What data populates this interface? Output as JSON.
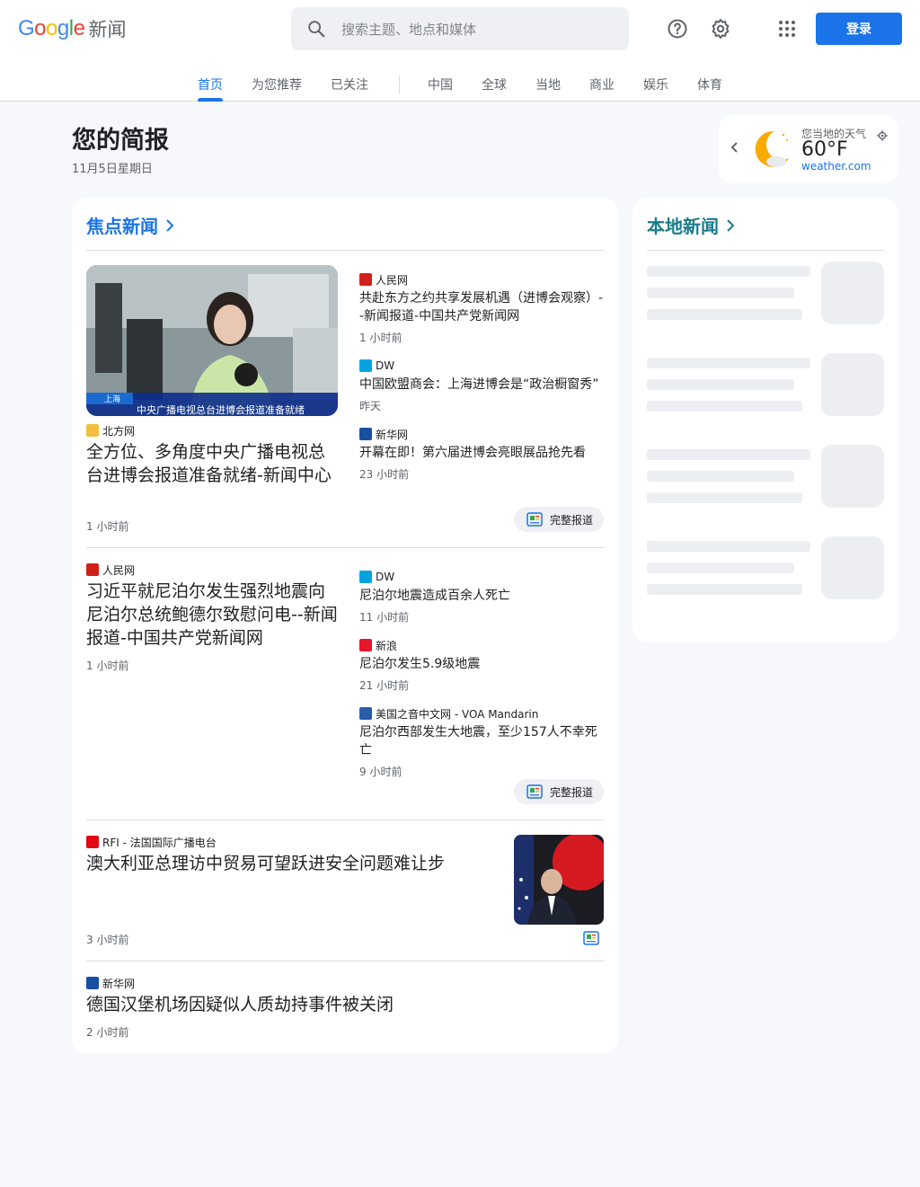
{
  "header": {
    "logo_text": "Google",
    "product": "新闻",
    "search_placeholder": "搜索主题、地点和媒体",
    "login_label": "登录"
  },
  "tabs": [
    {
      "label": "首页",
      "active": true
    },
    {
      "label": "为您推荐"
    },
    {
      "label": "已关注"
    },
    {
      "label": "中国"
    },
    {
      "label": "全球"
    },
    {
      "label": "当地"
    },
    {
      "label": "商业"
    },
    {
      "label": "娱乐"
    },
    {
      "label": "体育"
    }
  ],
  "briefing": {
    "title": "您的简报",
    "date": "11月5日星期日"
  },
  "weather": {
    "label": "您当地的天气",
    "temp": "60°F",
    "source": "weather.com"
  },
  "top_stories": {
    "heading": "焦点新闻",
    "full_coverage_label": "完整报道",
    "cluster1": {
      "image_caption": "中央广播电视总台进博会报道准备就绪",
      "image_tag": "上海",
      "main": {
        "source": "北方网",
        "title": "全方位、多角度中央广播电视总台进博会报道准备就绪-新闻中心",
        "time": "1 小时前"
      },
      "related": [
        {
          "source": "人民网",
          "title": "共赴东方之约共享发展机遇（进博会观察）--新闻报道-中国共产党新闻网",
          "time": "1 小时前"
        },
        {
          "source": "DW",
          "title": "中国欧盟商会：上海进博会是“政治橱窗秀”",
          "time": "昨天"
        },
        {
          "source": "新华网",
          "title": "开幕在即！第六届进博会亮眼展品抢先看",
          "time": "23 小时前"
        }
      ]
    },
    "cluster2": {
      "main": {
        "source": "人民网",
        "title": "习近平就尼泊尔发生强烈地震向尼泊尔总统鲍德尔致慰问电--新闻报道-中国共产党新闻网",
        "time": "1 小时前"
      },
      "related": [
        {
          "source": "DW",
          "title": "尼泊尔地震造成百余人死亡",
          "time": "11 小时前"
        },
        {
          "source": "新浪",
          "title": "尼泊尔发生5.9级地震",
          "time": "21 小时前"
        },
        {
          "source": "美国之音中文网 - VOA Mandarin",
          "title": "尼泊尔西部发生大地震，至少157人不幸死亡",
          "time": "9 小时前"
        }
      ]
    },
    "story3": {
      "source": "RFI - 法国国际广播电台",
      "title": "澳大利亚总理访中贸易可望跃进安全问题难让步",
      "time": "3 小时前"
    },
    "story4": {
      "source": "新华网",
      "title": "德国汉堡机场因疑似人质劫持事件被关闭",
      "time": "2 小时前"
    }
  },
  "local_news": {
    "heading": "本地新闻"
  },
  "colors": {
    "accent": "#1a73e8",
    "teal": "#1b7b8a",
    "background": "#f6f8fc"
  }
}
